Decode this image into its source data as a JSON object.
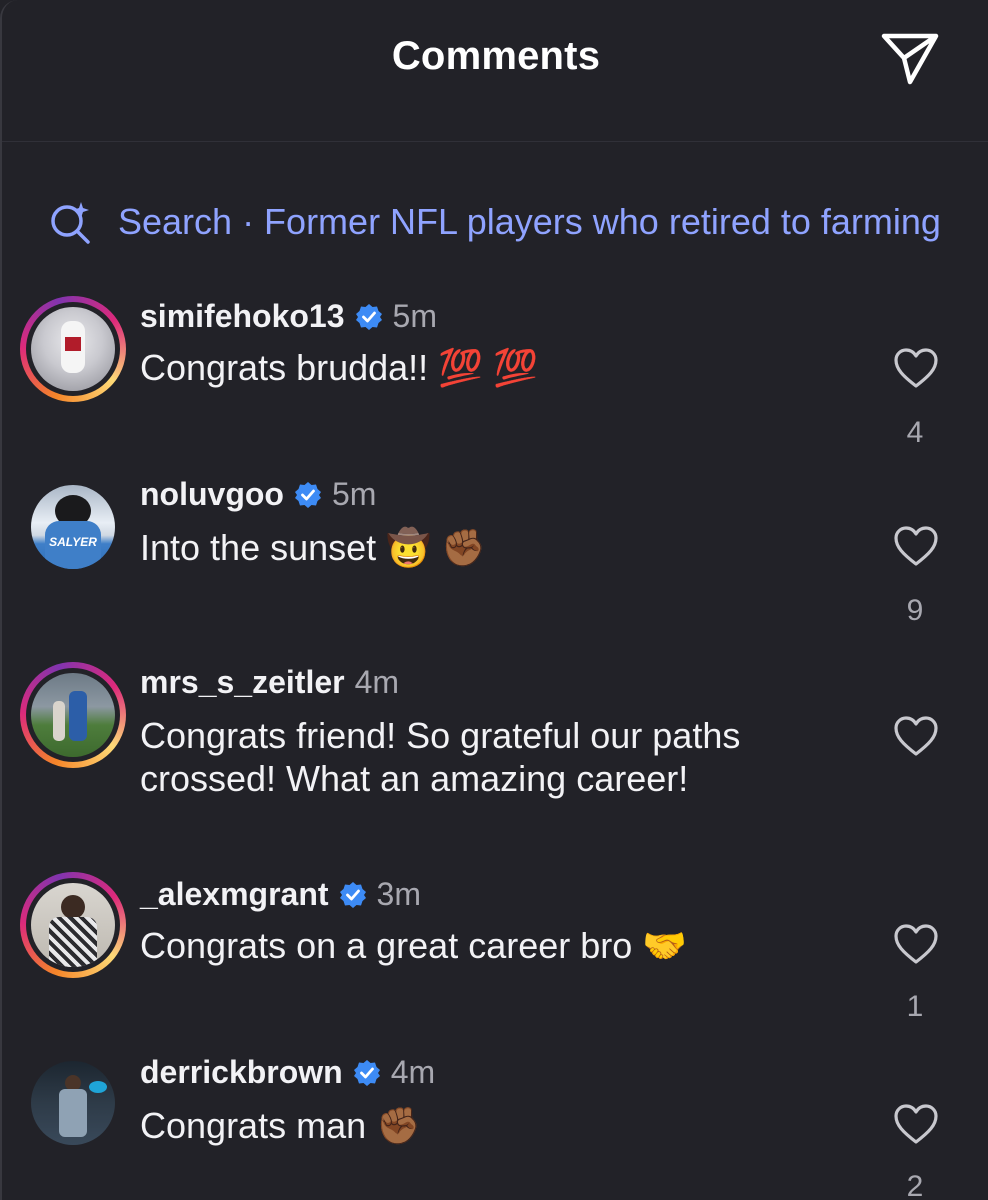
{
  "header": {
    "title": "Comments",
    "share_icon": "paper-plane-icon"
  },
  "search": {
    "icon": "sparkle-search-icon",
    "label": "Search · Former NFL players who retired to farming"
  },
  "colors": {
    "background": "#222228",
    "accent": "#8fa3ff",
    "verified": "#3d8bf5",
    "muted": "#a8a8b0"
  },
  "comments": [
    {
      "username": "simifehoko13",
      "verified": true,
      "time": "5m",
      "text": "Congrats brudda!! 💯 💯",
      "likes": "4",
      "story_ring": true
    },
    {
      "username": "noluvgoo",
      "verified": true,
      "time": "5m",
      "text": "Into the sunset 🤠 ✊🏾",
      "likes": "9",
      "story_ring": false,
      "avatar_caption": "SALYER"
    },
    {
      "username": "mrs_s_zeitler",
      "verified": false,
      "time": "4m",
      "text": "Congrats friend! So grateful our paths crossed! What an amazing career!",
      "likes": "",
      "story_ring": true
    },
    {
      "username": "_alexmgrant",
      "verified": true,
      "time": "3m",
      "text": "Congrats on a great career bro 🤝",
      "likes": "1",
      "story_ring": true
    },
    {
      "username": "derrickbrown",
      "verified": true,
      "time": "4m",
      "text": "Congrats man ✊🏾",
      "likes": "2",
      "story_ring": false
    }
  ]
}
